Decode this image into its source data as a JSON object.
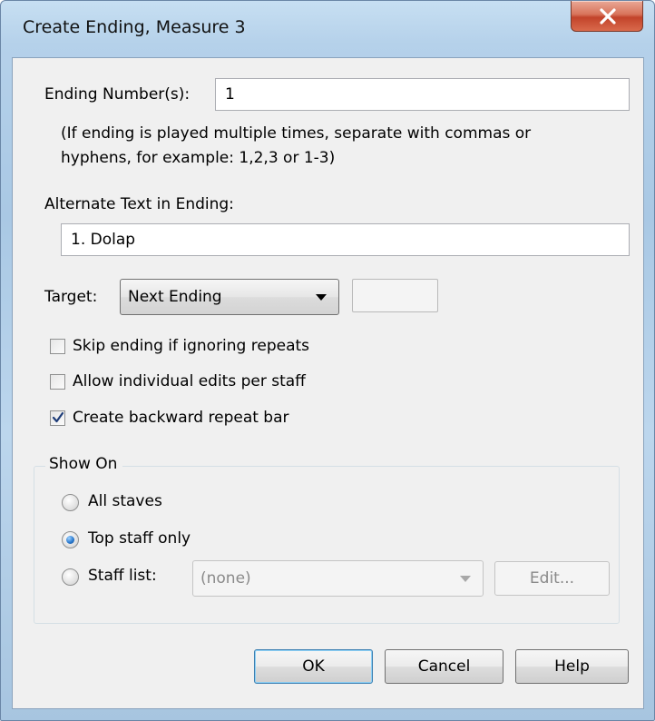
{
  "window": {
    "title": "Create Ending, Measure 3",
    "close_icon": "close-icon"
  },
  "ending_number": {
    "label": "Ending Number(s):",
    "value": "1",
    "hint_line1": "(If ending is played multiple times, separate with commas or",
    "hint_line2": "hyphens, for example: 1,2,3 or 1-3)"
  },
  "alternate_text": {
    "label": "Alternate Text in Ending:",
    "value": "1. Dolap"
  },
  "target": {
    "label": "Target:",
    "selected": "Next Ending",
    "extra_value": ""
  },
  "options": [
    {
      "label": "Skip ending if ignoring repeats",
      "checked": false
    },
    {
      "label": "Allow individual edits per staff",
      "checked": false
    },
    {
      "label": "Create backward repeat bar",
      "checked": true
    }
  ],
  "show_on": {
    "title": "Show On",
    "all_staves": "All staves",
    "top_staff_only": "Top staff only",
    "staff_list": "Staff list:",
    "staff_list_value": "(none)",
    "edit_label": "Edit...",
    "selected": "top_staff_only"
  },
  "buttons": {
    "ok": "OK",
    "cancel": "Cancel",
    "help": "Help"
  }
}
